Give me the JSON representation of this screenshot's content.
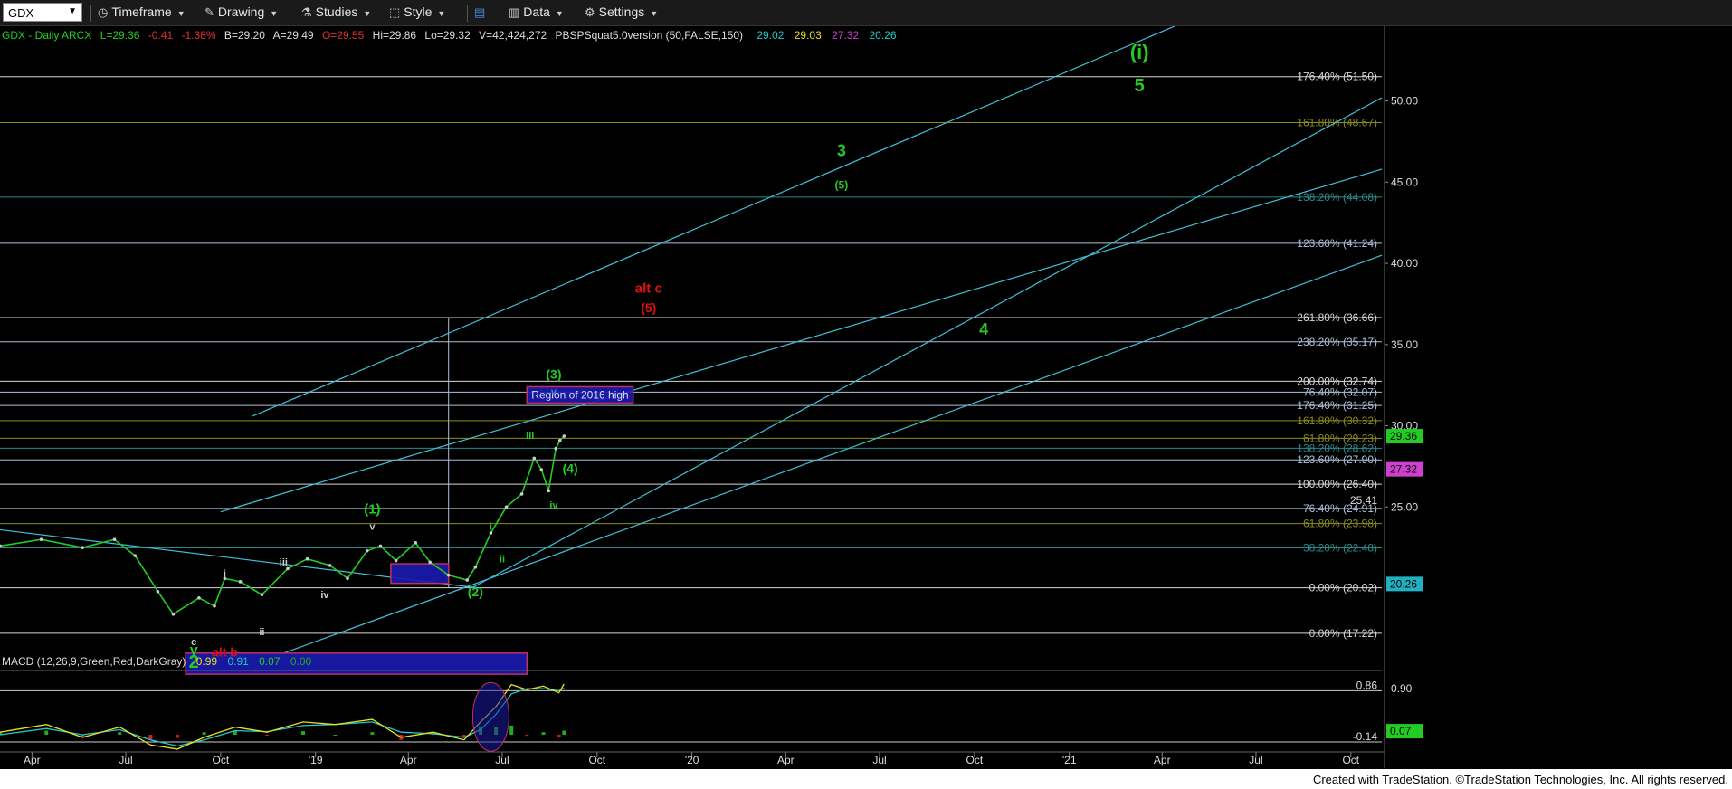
{
  "toolbar": {
    "symbol": "GDX",
    "timeframe_label": "Timeframe",
    "drawing_label": "Drawing",
    "studies_label": "Studies",
    "style_label": "Style",
    "data_label": "Data",
    "settings_label": "Settings"
  },
  "info_line": {
    "prefix": "GDX - Daily  ARCX",
    "L": "L=29.36",
    "chg": "-0.41",
    "pct": "-1.38%",
    "B": "B=29.20",
    "A": "A=29.49",
    "O": "O=29.55",
    "Hi": "Hi=29.86",
    "Lo": "Lo=29.32",
    "V": "V=42,424,272",
    "study": "PBSPSquat5.0version (50,FALSE,150)",
    "v1": "29.02",
    "v2": "29.03",
    "v3": "27.32",
    "v4": "20.26"
  },
  "macd_line": {
    "label": "MACD (12,26,9,Green,Red,DarkGray)",
    "v1": "0.99",
    "v2": "0.91",
    "v3": "0.07",
    "v4": "0.00"
  },
  "footer": "Created with TradeStation. ©TradeStation Technologies, Inc. All rights reserved.",
  "chart_data": {
    "type": "line",
    "instrument": "GDX - Daily",
    "x_tick_labels": [
      "Apr",
      "Jul",
      "Oct",
      "'19",
      "Apr",
      "Jul",
      "Oct",
      "'20",
      "Apr",
      "Jul",
      "Oct",
      "'21",
      "Apr",
      "Jul",
      "Oct"
    ],
    "x_tick_dates": [
      "2018-04-01",
      "2018-07-01",
      "2018-10-01",
      "2019-01-01",
      "2019-04-01",
      "2019-07-01",
      "2019-10-01",
      "2020-01-01",
      "2020-04-01",
      "2020-07-01",
      "2020-10-01",
      "2021-01-01",
      "2021-04-01",
      "2021-07-01",
      "2021-10-01"
    ],
    "y_tick_labels": [
      "50.00",
      "45.00",
      "40.00",
      "35.00",
      "30.00",
      "25.00"
    ],
    "ylim": [
      15.6,
      53.6
    ],
    "price_series": {
      "name": "GDX",
      "x": [
        "2018-03-01",
        "2018-04-10",
        "2018-05-20",
        "2018-06-20",
        "2018-07-10",
        "2018-08-01",
        "2018-08-16",
        "2018-09-10",
        "2018-09-25",
        "2018-10-05",
        "2018-10-20",
        "2018-11-10",
        "2018-12-05",
        "2018-12-24",
        "2019-01-15",
        "2019-02-01",
        "2019-02-20",
        "2019-03-05",
        "2019-03-20",
        "2019-04-08",
        "2019-04-22",
        "2019-05-10",
        "2019-05-28",
        "2019-06-05",
        "2019-06-20",
        "2019-07-05",
        "2019-07-20",
        "2019-08-01",
        "2019-08-08",
        "2019-08-15",
        "2019-08-22",
        "2019-08-26",
        "2019-08-30"
      ],
      "y": [
        22.6,
        23.0,
        22.5,
        23.0,
        22.0,
        19.8,
        18.4,
        19.4,
        18.9,
        20.6,
        20.4,
        19.6,
        21.2,
        21.8,
        21.4,
        20.6,
        22.3,
        22.6,
        21.7,
        22.8,
        21.6,
        20.8,
        20.5,
        21.3,
        23.4,
        25.0,
        25.8,
        28.0,
        27.3,
        26.0,
        28.6,
        29.1,
        29.36
      ]
    },
    "fib_levels": [
      {
        "label": "176.40% (51.50)",
        "value": 51.5,
        "color": "#d8d8d8"
      },
      {
        "label": "161.80% (48.67)",
        "value": 48.67,
        "color": "#8b8b1a"
      },
      {
        "label": "138.20% (44.08)",
        "value": 44.08,
        "color": "#2a8a8a"
      },
      {
        "label": "123.60% (41.24)",
        "value": 41.24,
        "color": "#b0c0d8"
      },
      {
        "label": "261.80% (36.66)",
        "value": 36.66,
        "color": "#d8d8d8"
      },
      {
        "label": "238.20% (35.17)",
        "value": 35.17,
        "color": "#b0c0d8"
      },
      {
        "label": "200.00% (32.74)",
        "value": 32.74,
        "color": "#d8d8d8"
      },
      {
        "label": "76.40% (32.07)",
        "value": 32.07,
        "color": "#b0c0d8"
      },
      {
        "label": "176.40% (31.25)",
        "value": 31.25,
        "color": "#b0c0d8"
      },
      {
        "label": "161.80% (30.32)",
        "value": 30.32,
        "color": "#8b8b1a"
      },
      {
        "label": "61.80% (29.23)",
        "value": 29.23,
        "color": "#8b8b1a"
      },
      {
        "label": "138.20% (28.62)",
        "value": 28.62,
        "color": "#2a8a8a"
      },
      {
        "label": "123.60% (27.90)",
        "value": 27.9,
        "color": "#b0c0d8"
      },
      {
        "label": "100.00% (26.40)",
        "value": 26.4,
        "color": "#d8d8d8"
      },
      {
        "label": "76.40% (24.91)",
        "value": 24.91,
        "color": "#b0c0d8"
      },
      {
        "label": "61.80% (23.98)",
        "value": 23.98,
        "color": "#8b8b1a"
      },
      {
        "label": "38.20% (22.48)",
        "value": 22.48,
        "color": "#2a8a8a"
      },
      {
        "label": "0.00% (20.02)",
        "value": 20.02,
        "color": "#d8d8d8"
      },
      {
        "label": "0.00% (17.22)",
        "value": 17.22,
        "color": "#d8d8d8"
      }
    ],
    "extra_level_label": "25.41",
    "wave_labels": [
      {
        "text": "(i)",
        "x": "2021-03-10",
        "y": 52.6,
        "color": "#22cc22",
        "size": 22
      },
      {
        "text": "5",
        "x": "2021-03-10",
        "y": 50.6,
        "color": "#22cc22",
        "size": 20
      },
      {
        "text": "3",
        "x": "2020-05-25",
        "y": 46.6,
        "color": "#22cc22",
        "size": 18
      },
      {
        "text": "(5)",
        "x": "2020-05-25",
        "y": 44.6,
        "color": "#22cc22",
        "size": 12
      },
      {
        "text": "alt c",
        "x": "2019-11-20",
        "y": 38.2,
        "color": "#dd1111",
        "size": 15
      },
      {
        "text": "(5)",
        "x": "2019-11-20",
        "y": 37.0,
        "color": "#dd1111",
        "size": 14
      },
      {
        "text": "4",
        "x": "2020-10-10",
        "y": 35.6,
        "color": "#22cc22",
        "size": 18
      },
      {
        "text": "(3)",
        "x": "2019-08-20",
        "y": 32.9,
        "color": "#22cc22",
        "size": 14
      },
      {
        "text": "v",
        "x": "2019-08-20",
        "y": 31.9,
        "color": "#4a80c8",
        "size": 11
      },
      {
        "text": "iii",
        "x": "2019-07-28",
        "y": 29.2,
        "color": "#22cc22",
        "size": 11
      },
      {
        "text": "(4)",
        "x": "2019-09-05",
        "y": 27.1,
        "color": "#22cc22",
        "size": 14
      },
      {
        "text": "iv",
        "x": "2019-08-20",
        "y": 24.9,
        "color": "#22cc22",
        "size": 11
      },
      {
        "text": "(1)",
        "x": "2019-02-25",
        "y": 24.6,
        "color": "#22cc22",
        "size": 15
      },
      {
        "text": "v",
        "x": "2019-02-25",
        "y": 23.6,
        "color": "#cccccc",
        "size": 11
      },
      {
        "text": "i",
        "x": "2019-06-20",
        "y": 23.6,
        "color": "#22cc22",
        "size": 11
      },
      {
        "text": "ii",
        "x": "2019-07-01",
        "y": 21.6,
        "color": "#22cc22",
        "size": 11
      },
      {
        "text": "iii",
        "x": "2018-12-01",
        "y": 21.4,
        "color": "#cccccc",
        "size": 11
      },
      {
        "text": "i",
        "x": "2018-10-05",
        "y": 20.7,
        "color": "#cccccc",
        "size": 11
      },
      {
        "text": "iv",
        "x": "2019-01-10",
        "y": 19.4,
        "color": "#cccccc",
        "size": 11
      },
      {
        "text": "ii",
        "x": "2018-11-10",
        "y": 17.1,
        "color": "#cccccc",
        "size": 11
      },
      {
        "text": "(2)",
        "x": "2019-06-05",
        "y": 19.5,
        "color": "#22cc22",
        "size": 14
      },
      {
        "text": "c",
        "x": "2018-09-05",
        "y": 16.5,
        "color": "#cccccc",
        "size": 11
      },
      {
        "text": "y",
        "x": "2018-09-05",
        "y": 15.9,
        "color": "#22cc22",
        "size": 16
      },
      {
        "text": "2",
        "x": "2018-09-05",
        "y": 15.1,
        "color": "#22cc22",
        "size": 20
      },
      {
        "text": "alt b",
        "x": "2018-10-05",
        "y": 15.8,
        "color": "#dd1111",
        "size": 14
      }
    ],
    "region_boxes": [
      {
        "label": "Region of 2016 high",
        "x0": "2019-07-25",
        "x1": "2019-11-05",
        "y0": 31.4,
        "y1": 32.4
      },
      {
        "label": "",
        "x0": "2018-08-28",
        "x1": "2019-07-25",
        "y0": 14.7,
        "y1": 16.0
      },
      {
        "label": "",
        "x0": "2019-03-15",
        "x1": "2019-05-10",
        "y0": 20.3,
        "y1": 21.5
      }
    ],
    "channel_lines": [
      {
        "x0": "2018-11-01",
        "y0": 30.6,
        "x1": "2021-07-15",
        "y1": 57.1
      },
      {
        "x0": "2018-10-01",
        "y0": 24.7,
        "x1": "2021-10-31",
        "y1": 45.8
      },
      {
        "x0": "2018-12-01",
        "y0": 16.0,
        "x1": "2021-10-31",
        "y1": 40.5
      },
      {
        "x0": "2019-06-01",
        "y0": 20.0,
        "x1": "2021-10-31",
        "y1": 50.2
      },
      {
        "x0": "2018-03-01",
        "y0": 23.6,
        "x1": "2019-06-10",
        "y1": 20.0
      }
    ],
    "price_badges": [
      {
        "text": "29.36",
        "value": 29.36,
        "color": "#22cc22"
      },
      {
        "text": "27.32",
        "value": 27.32,
        "color": "#d040d0"
      },
      {
        "text": "20.26",
        "value": 20.26,
        "color": "#20b0c0"
      }
    ],
    "macd": {
      "y_tick_labels": [
        "0.90",
        "0.05"
      ],
      "level_labels": [
        "0.86",
        "-0.14"
      ],
      "badge": "0.07",
      "ylim": [
        -0.3,
        1.15
      ],
      "x": [
        "2018-03-01",
        "2018-04-15",
        "2018-05-20",
        "2018-06-25",
        "2018-07-25",
        "2018-08-20",
        "2018-09-15",
        "2018-10-15",
        "2018-11-15",
        "2018-12-20",
        "2019-01-20",
        "2019-02-25",
        "2019-03-25",
        "2019-04-25",
        "2019-05-25",
        "2019-06-10",
        "2019-06-25",
        "2019-07-10",
        "2019-07-25",
        "2019-08-10",
        "2019-08-25",
        "2019-08-30"
      ],
      "macd": [
        0.05,
        0.2,
        -0.05,
        0.15,
        -0.2,
        -0.28,
        -0.05,
        0.15,
        0.05,
        0.25,
        0.2,
        0.3,
        -0.05,
        0.05,
        -0.1,
        0.25,
        0.55,
        0.98,
        0.88,
        0.95,
        0.82,
        0.99
      ],
      "signal": [
        0.0,
        0.12,
        0.0,
        0.1,
        -0.1,
        -0.22,
        -0.1,
        0.08,
        0.06,
        0.18,
        0.2,
        0.25,
        0.05,
        0.02,
        -0.05,
        0.1,
        0.4,
        0.8,
        0.9,
        0.9,
        0.86,
        0.91
      ]
    }
  }
}
